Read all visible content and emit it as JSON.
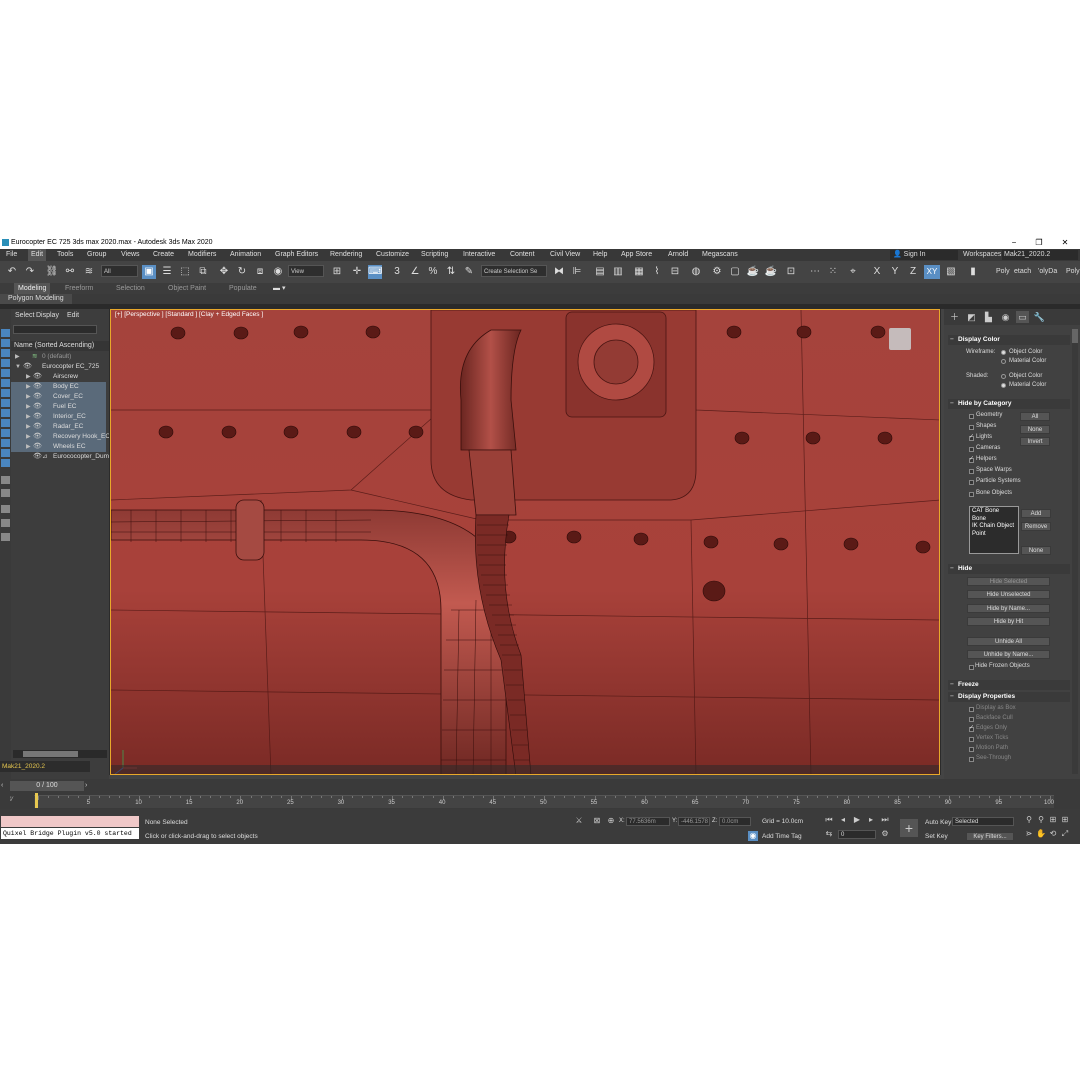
{
  "window": {
    "title": "Eurocopter EC 725 3ds max 2020.max - Autodesk 3ds Max 2020",
    "minimize": "−",
    "maximize": "❐",
    "close": "✕"
  },
  "menubar": {
    "items": [
      "File",
      "Edit",
      "Tools",
      "Group",
      "Views",
      "Create",
      "Modifiers",
      "Animation",
      "Graph Editors",
      "Rendering",
      "Customize",
      "Scripting",
      "Interactive",
      "Content",
      "Civil View",
      "Help",
      "App Store",
      "Arnold",
      "Megascans"
    ],
    "signin": "Sign In",
    "workspaces_label": "Workspaces:",
    "workspace_value": "Mak21_2020.2"
  },
  "toolbar": {
    "filter_value": "All",
    "coord_value": "View",
    "selection_set_value": "Create Selection Se",
    "axis_x": "X",
    "axis_y": "Y",
    "axis_z": "Z",
    "axis_xy": "XY",
    "poly_tabs": [
      "Poly",
      "etach",
      "'olyDa",
      "Poly"
    ]
  },
  "ribbon": {
    "tabs": [
      "Modeling",
      "Freeform",
      "Selection",
      "Object Paint",
      "Populate"
    ],
    "sub": "Polygon Modeling"
  },
  "explorer": {
    "menu": [
      "Select",
      "Display",
      "Edit"
    ],
    "header": "Name (Sorted Ascending)",
    "rows": [
      "0 (default)",
      "Eurocopter EC_725",
      "Airscrew",
      "Body EC",
      "Cover_EC",
      "Fuel EC",
      "Interior_EC",
      "Radar_EC",
      "Recovery Hook_EC",
      "Wheels EC",
      "Eurococopter_Dum"
    ],
    "layer": "Mak21_2020.2"
  },
  "viewport": {
    "label": "[+] [Perspective ] [Standard ] [Clay + Edged Faces ]"
  },
  "command_panel": {
    "display_color": {
      "title": "Display Color",
      "wireframe_label": "Wireframe:",
      "shaded_label": "Shaded:",
      "object_color": "Object Color",
      "material_color": "Material Color"
    },
    "hide_by_category": {
      "title": "Hide by Category",
      "items": [
        "Geometry",
        "Shapes",
        "Lights",
        "Cameras",
        "Helpers",
        "Space Warps",
        "Particle Systems",
        "Bone Objects"
      ],
      "checked": [
        false,
        false,
        true,
        false,
        true,
        false,
        false,
        false
      ],
      "buttons": [
        "All",
        "None",
        "Invert"
      ],
      "list": [
        "CAT Bone",
        "Bone",
        "IK Chain Object",
        "Point"
      ],
      "list_buttons": [
        "Add",
        "Remove",
        "None"
      ]
    },
    "hide": {
      "title": "Hide",
      "buttons": [
        "Hide Selected",
        "Hide Unselected",
        "Hide by Name...",
        "Hide by Hit",
        "Unhide All",
        "Unhide by Name..."
      ],
      "frozen": "Hide Frozen Objects"
    },
    "freeze": {
      "title": "Freeze"
    },
    "display_properties": {
      "title": "Display Properties",
      "items": [
        "Display as Box",
        "Backface Cull",
        "Edges Only",
        "Vertex Ticks",
        "Motion Path",
        "See-Through"
      ]
    }
  },
  "timeline": {
    "slider": "0 / 100",
    "ticks": [
      "5",
      "10",
      "15",
      "20",
      "25",
      "30",
      "35",
      "40",
      "45",
      "50",
      "55",
      "60",
      "65",
      "70",
      "75",
      "80",
      "85",
      "90",
      "95",
      "100"
    ]
  },
  "status": {
    "maxscript_output": "Quixel Bridge Plugin v5.0 started",
    "selection": "None Selected",
    "prompt": "Click or click-and-drag to select objects",
    "x_label": "X:",
    "x_value": "77.5636m",
    "y_label": "Y:",
    "y_value": "-446.1578",
    "z_label": "Z:",
    "z_value": "0.0cm",
    "grid": "Grid = 10.0cm",
    "add_time_tag": "Add Time Tag",
    "frame": "0",
    "auto_key": "Auto Key",
    "set_key": "Set Key",
    "selected": "Selected",
    "key_filters": "Key Filters..."
  },
  "colors": {
    "viewport_red": "#a8413a",
    "accent_blue": "#5a8fc4",
    "active_border": "#e8a82a"
  }
}
